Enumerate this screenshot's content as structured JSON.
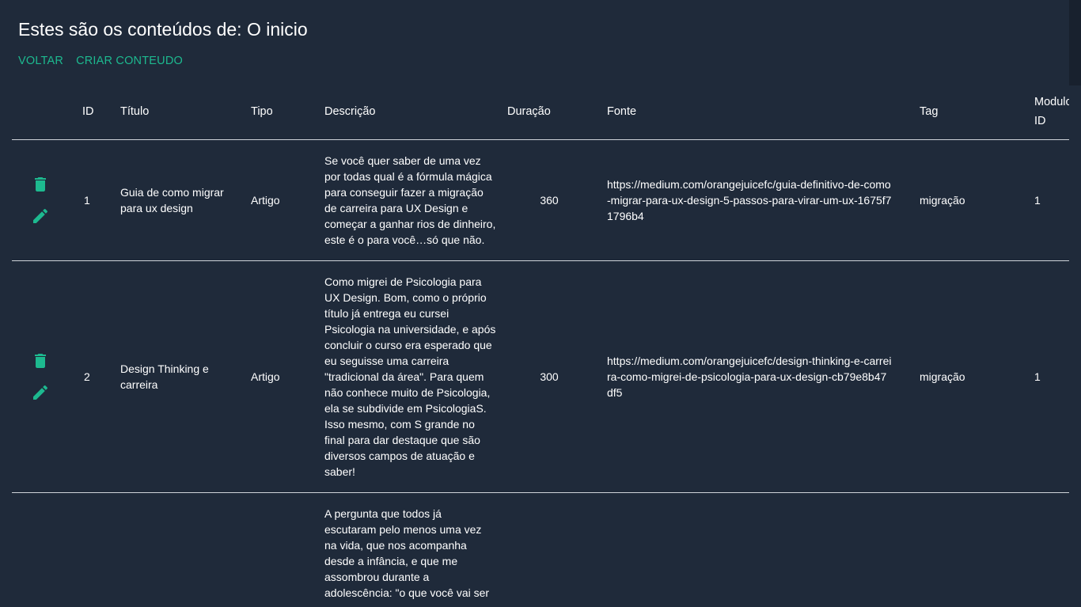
{
  "page": {
    "title": "Estes são os conteúdos de: O inicio",
    "actions": {
      "back": "VOLTAR",
      "create": "CRIAR CONTEUDO"
    }
  },
  "colors": {
    "background": "#1f2a3a",
    "accent": "#1db98f",
    "text": "#ffffff"
  },
  "table": {
    "columns": [
      "",
      "ID",
      "Título",
      "Tipo",
      "Descrição",
      "Duração",
      "Fonte",
      "Tag",
      "Modulo ID"
    ],
    "rows": [
      {
        "id": "1",
        "titulo": "Guia de como migrar para ux design",
        "tipo": "Artigo",
        "descricao": "Se você quer saber de uma vez por todas qual é a fórmula mágica para conseguir fazer a migração de carreira para UX Design e começar a ganhar rios de dinheiro, este é o para você…só que não.",
        "duracao": "360",
        "fonte": "https://medium.com/orangejuicefc/guia-definitivo-de-como-migrar-para-ux-design-5-passos-para-virar-um-ux-1675f71796b4",
        "tag": "migração",
        "modulo_id": "1",
        "icons": [
          "delete-icon",
          "edit-icon"
        ]
      },
      {
        "id": "2",
        "titulo": "Design Thinking e carreira",
        "tipo": "Artigo",
        "descricao": "Como migrei de Psicologia para UX Design. Bom, como o próprio título já entrega eu cursei Psicologia na universidade, e após concluir o curso era esperado que eu seguisse uma carreira \"tradicional da área\". Para quem não conhece muito de Psicologia, ela se subdivide em PsicologiaS. Isso mesmo, com S grande no final para dar destaque que são diversos campos de atuação e saber!",
        "duracao": "300",
        "fonte": "https://medium.com/orangejuicefc/design-thinking-e-carreira-como-migrei-de-psicologia-para-ux-design-cb79e8b47df5",
        "tag": "migração",
        "modulo_id": "1",
        "icons": [
          "delete-icon",
          "edit-icon"
        ]
      },
      {
        "id": "",
        "titulo": "",
        "tipo": "",
        "descricao": "A pergunta que todos já escutaram pelo menos uma vez na vida, que nos acompanha desde a infância, e que me assombrou durante a adolescência: \"o que você vai ser",
        "duracao": "",
        "fonte": "",
        "tag": "",
        "modulo_id": "",
        "icons": []
      }
    ]
  }
}
